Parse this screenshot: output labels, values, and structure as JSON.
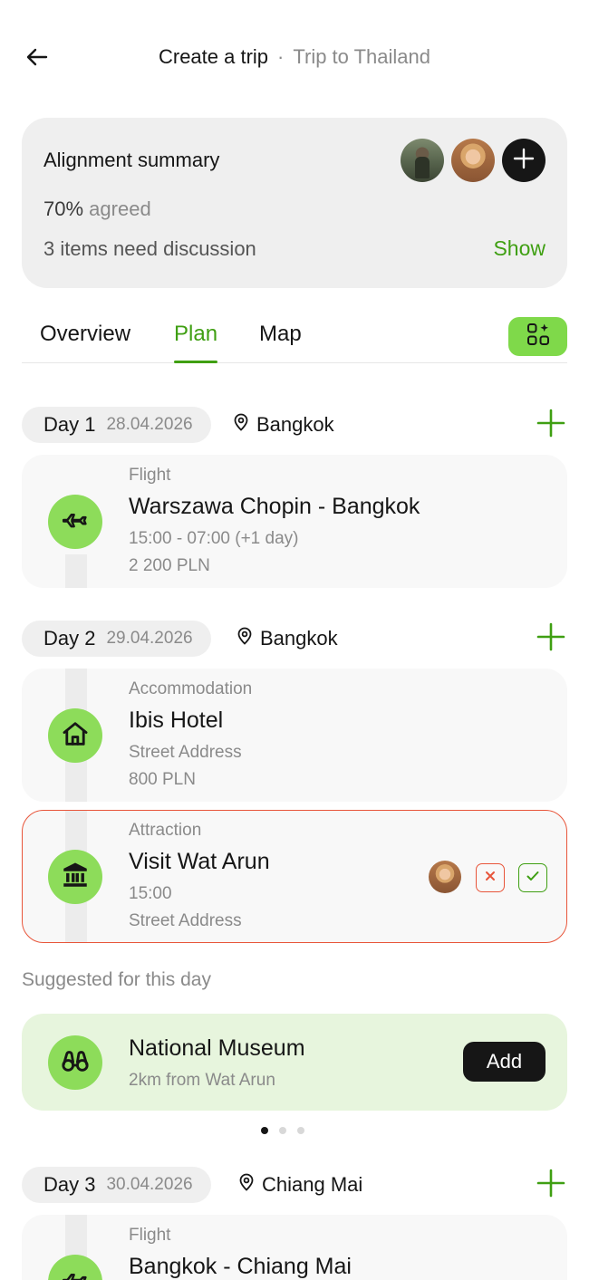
{
  "header": {
    "title": "Create a trip",
    "separator": "·",
    "subtitle": "Trip to Thailand"
  },
  "summary": {
    "title": "Alignment summary",
    "agreed_value": "70%",
    "agreed_label": "agreed",
    "discussion": "3 items need discussion",
    "show_label": "Show"
  },
  "tabs": [
    {
      "label": "Overview"
    },
    {
      "label": "Plan"
    },
    {
      "label": "Map"
    }
  ],
  "active_tab": "Plan",
  "days": [
    {
      "label": "Day 1",
      "date": "28.04.2026",
      "location": "Bangkok",
      "items": [
        {
          "type": "Flight",
          "name": "Warszawa Chopin - Bangkok",
          "line3": "15:00 - 07:00 (+1 day)",
          "line4": "2 200 PLN",
          "icon": "plane-icon"
        }
      ]
    },
    {
      "label": "Day 2",
      "date": "29.04.2026",
      "location": "Bangkok",
      "items": [
        {
          "type": "Accommodation",
          "name": "Ibis Hotel",
          "line3": "Street Address",
          "line4": "800 PLN",
          "icon": "home-icon"
        },
        {
          "type": "Attraction",
          "name": "Visit Wat Arun",
          "line3": "15:00",
          "line4": "Street Address",
          "icon": "temple-icon"
        }
      ]
    },
    {
      "label": "Day 3",
      "date": "30.04.2026",
      "location": "Chiang Mai",
      "items": [
        {
          "type": "Flight",
          "name": "Bangkok - Chiang Mai",
          "icon": "plane-icon"
        }
      ]
    }
  ],
  "suggested": {
    "label": "Suggested for this day",
    "name": "National Museum",
    "distance": "2km from Wat Arun",
    "add_label": "Add",
    "icon": "binoculars-icon"
  },
  "carousel": {
    "pages": 3,
    "current": 1
  },
  "colors": {
    "accent_green": "#3f9f12",
    "icon_green": "#8ddc5a",
    "alert_red": "#e8553a",
    "suggest_bg": "#e7f5dd"
  }
}
